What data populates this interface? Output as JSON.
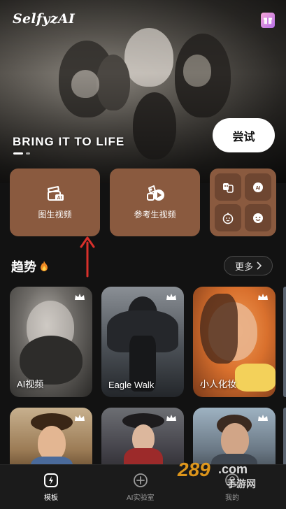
{
  "app": {
    "brand": "SelfyzAI"
  },
  "hero": {
    "tagline": "BRING IT TO LIFE",
    "cta_label": "尝试",
    "slide_count": 2,
    "active_slide": 0
  },
  "features": [
    {
      "label": "图生视频",
      "icon": "image-ai-icon"
    },
    {
      "label": "参考生视频",
      "icon": "reference-video-icon"
    }
  ],
  "mini_tools": [
    {
      "icon": "face-swap-icon"
    },
    {
      "icon": "ai-face-icon"
    },
    {
      "icon": "baby-face-icon"
    },
    {
      "icon": "emoji-face-icon"
    }
  ],
  "trending": {
    "title": "趋势",
    "more_label": "更多",
    "items": [
      {
        "caption": "AI视频",
        "premium": true
      },
      {
        "caption": "Eagle Walk",
        "premium": true
      },
      {
        "caption": "小人化妆",
        "premium": true
      },
      {
        "caption": "",
        "premium": true
      },
      {
        "caption": "",
        "premium": true
      },
      {
        "caption": "",
        "premium": true
      }
    ]
  },
  "nav": {
    "items": [
      {
        "label": "模板",
        "active": true
      },
      {
        "label": "AI实验室",
        "active": false
      },
      {
        "label": "我的",
        "active": false
      }
    ]
  },
  "watermark": {
    "text_main": "289.com",
    "text_sub": "手游网"
  },
  "colors": {
    "card": "#8a5a3f",
    "background": "#121212",
    "accent_arrow": "#d9302b"
  }
}
